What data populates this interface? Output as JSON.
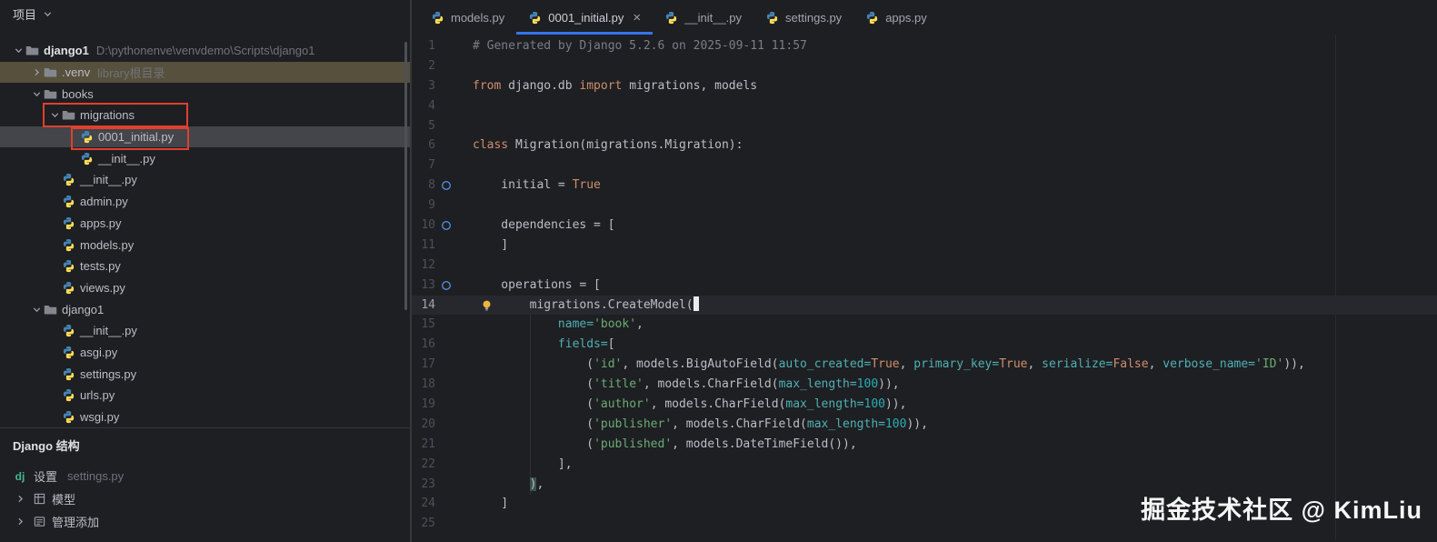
{
  "panel": {
    "header": "项目",
    "tree": [
      {
        "label": "django1",
        "detail": "D:\\pythonenve\\venvdemo\\Scripts\\django1",
        "icon": "folder",
        "level": 0,
        "chevron": "down",
        "bold": true
      },
      {
        "label": ".venv",
        "detail": "library根目录",
        "icon": "folder",
        "level": 1,
        "chevron": "right",
        "row_style": "library"
      },
      {
        "label": "books",
        "icon": "folder",
        "level": 1,
        "chevron": "down"
      },
      {
        "label": "migrations",
        "icon": "folder",
        "level": 2,
        "chevron": "down"
      },
      {
        "label": "0001_initial.py",
        "icon": "python",
        "level": 3,
        "selected": true
      },
      {
        "label": "__init__.py",
        "icon": "python",
        "level": 3
      },
      {
        "label": "__init__.py",
        "icon": "python",
        "level": 2
      },
      {
        "label": "admin.py",
        "icon": "python",
        "level": 2
      },
      {
        "label": "apps.py",
        "icon": "python",
        "level": 2
      },
      {
        "label": "models.py",
        "icon": "python",
        "level": 2
      },
      {
        "label": "tests.py",
        "icon": "python",
        "level": 2
      },
      {
        "label": "views.py",
        "icon": "python",
        "level": 2
      },
      {
        "label": "django1",
        "icon": "folder",
        "level": 1,
        "chevron": "down"
      },
      {
        "label": "__init__.py",
        "icon": "python",
        "level": 2
      },
      {
        "label": "asgi.py",
        "icon": "python",
        "level": 2
      },
      {
        "label": "settings.py",
        "icon": "python",
        "level": 2
      },
      {
        "label": "urls.py",
        "icon": "python",
        "level": 2
      },
      {
        "label": "wsgi.py",
        "icon": "python",
        "level": 2
      }
    ]
  },
  "django_panel": {
    "title": "Django 结构",
    "items": [
      {
        "icon": "dj",
        "label": "设置",
        "detail": "settings.py"
      },
      {
        "icon": "grid",
        "label": "模型",
        "chevron": true
      },
      {
        "icon": "list",
        "label": "管理添加",
        "chevron": true
      }
    ]
  },
  "tabs": [
    {
      "label": "models.py"
    },
    {
      "label": "0001_initial.py",
      "active": true,
      "closable": true
    },
    {
      "label": "__init__.py"
    },
    {
      "label": "settings.py"
    },
    {
      "label": "apps.py"
    }
  ],
  "editor": {
    "current_line": 14,
    "lines": [
      {
        "n": 1,
        "seg": [
          [
            "# Generated by Django 5.2.6 on 2025-09-11 11:57",
            "c"
          ]
        ]
      },
      {
        "n": 2,
        "seg": []
      },
      {
        "n": 3,
        "seg": [
          [
            "from",
            "k"
          ],
          [
            " django.db ",
            "d"
          ],
          [
            "import",
            "k"
          ],
          [
            " migrations, models",
            "d"
          ]
        ]
      },
      {
        "n": 4,
        "seg": []
      },
      {
        "n": 5,
        "seg": []
      },
      {
        "n": 6,
        "seg": [
          [
            "class",
            "k"
          ],
          [
            " Migration(migrations.Migration):",
            "d"
          ]
        ]
      },
      {
        "n": 7,
        "seg": []
      },
      {
        "n": 8,
        "seg": [
          [
            "    initial = ",
            "d"
          ],
          [
            "True",
            "k"
          ]
        ],
        "gicon": "override"
      },
      {
        "n": 9,
        "seg": []
      },
      {
        "n": 10,
        "seg": [
          [
            "    dependencies = [",
            "d"
          ]
        ],
        "gicon": "override"
      },
      {
        "n": 11,
        "seg": [
          [
            "    ]",
            "d"
          ]
        ]
      },
      {
        "n": 12,
        "seg": []
      },
      {
        "n": 13,
        "seg": [
          [
            "    operations = [",
            "d"
          ]
        ],
        "gicon": "override"
      },
      {
        "n": 14,
        "seg": [
          [
            "        migrations.CreateModel(",
            "d"
          ],
          [
            "",
            "caret"
          ]
        ],
        "current": true,
        "bulb": true
      },
      {
        "n": 15,
        "seg": [
          [
            "            ",
            "d"
          ],
          [
            "name=",
            "p"
          ],
          [
            "'book'",
            "s"
          ],
          [
            ",",
            "d"
          ]
        ]
      },
      {
        "n": 16,
        "seg": [
          [
            "            ",
            "d"
          ],
          [
            "fields=",
            "p"
          ],
          [
            "[",
            "d"
          ]
        ]
      },
      {
        "n": 17,
        "seg": [
          [
            "                (",
            "d"
          ],
          [
            "'id'",
            "s"
          ],
          [
            ", models.BigAutoField(",
            "d"
          ],
          [
            "auto_created=",
            "p"
          ],
          [
            "True",
            "k"
          ],
          [
            ", ",
            "d"
          ],
          [
            "primary_key=",
            "p"
          ],
          [
            "True",
            "k"
          ],
          [
            ", ",
            "d"
          ],
          [
            "serialize=",
            "p"
          ],
          [
            "False",
            "k"
          ],
          [
            ", ",
            "d"
          ],
          [
            "verbose_name=",
            "p"
          ],
          [
            "'ID'",
            "s"
          ],
          [
            ")),",
            "d"
          ]
        ]
      },
      {
        "n": 18,
        "seg": [
          [
            "                (",
            "d"
          ],
          [
            "'title'",
            "s"
          ],
          [
            ", models.CharField(",
            "d"
          ],
          [
            "max_length=",
            "p"
          ],
          [
            "100",
            "n"
          ],
          [
            ")),",
            "d"
          ]
        ]
      },
      {
        "n": 19,
        "seg": [
          [
            "                (",
            "d"
          ],
          [
            "'author'",
            "s"
          ],
          [
            ", models.CharField(",
            "d"
          ],
          [
            "max_length=",
            "p"
          ],
          [
            "100",
            "n"
          ],
          [
            ")),",
            "d"
          ]
        ]
      },
      {
        "n": 20,
        "seg": [
          [
            "                (",
            "d"
          ],
          [
            "'publisher'",
            "s"
          ],
          [
            ", models.CharField(",
            "d"
          ],
          [
            "max_length=",
            "p"
          ],
          [
            "100",
            "n"
          ],
          [
            ")),",
            "d"
          ]
        ]
      },
      {
        "n": 21,
        "seg": [
          [
            "                (",
            "d"
          ],
          [
            "'published'",
            "s"
          ],
          [
            ", models.DateTimeField()),",
            "d"
          ]
        ]
      },
      {
        "n": 22,
        "seg": [
          [
            "            ],",
            "d"
          ]
        ]
      },
      {
        "n": 23,
        "seg": [
          [
            "        ",
            "d"
          ],
          [
            ")",
            "bm"
          ],
          [
            ",",
            "d"
          ]
        ]
      },
      {
        "n": 24,
        "seg": [
          [
            "    ]",
            "d"
          ]
        ]
      },
      {
        "n": 25,
        "seg": []
      }
    ]
  },
  "watermark": "掘金技术社区 @ KimLiu",
  "colors": {
    "accent": "#3574f0",
    "annotation": "#e0402f",
    "selection": "#43454a",
    "library_row": "#57503c",
    "keyword": "#cf8e6d",
    "string": "#6aab73",
    "number": "#2aacb8",
    "comment": "#7a7e85"
  }
}
